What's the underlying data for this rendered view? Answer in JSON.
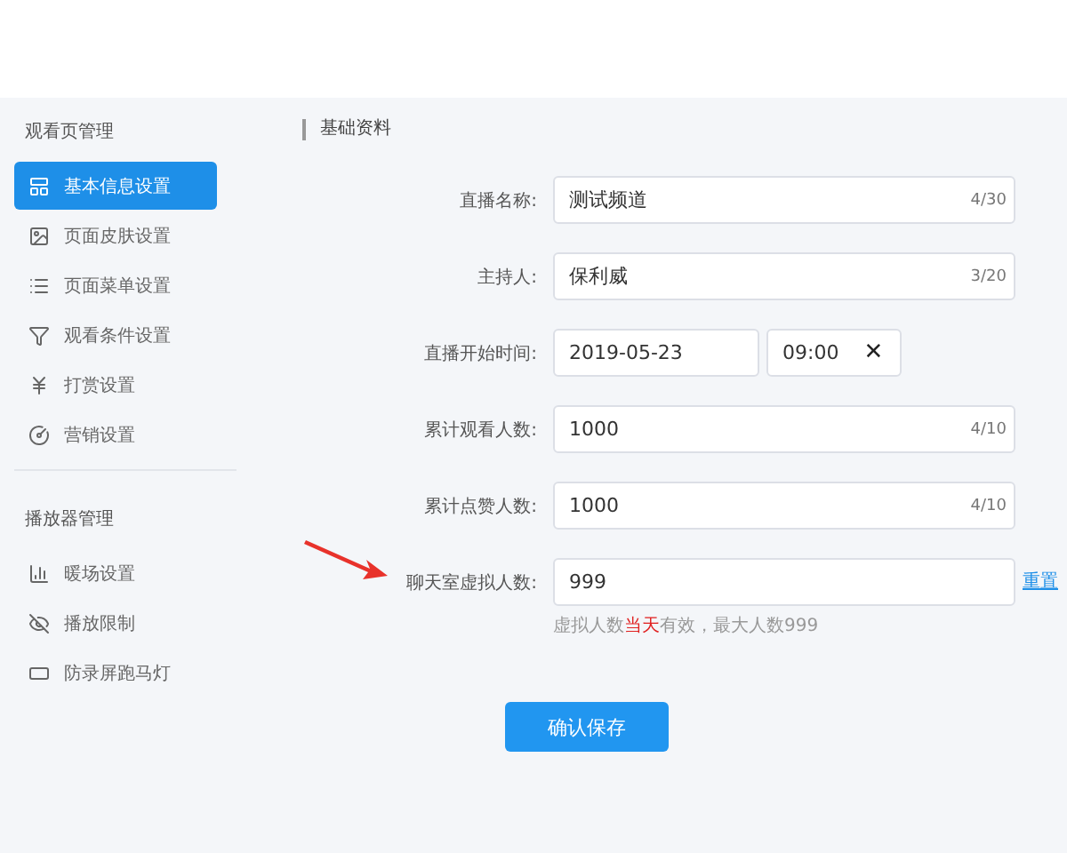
{
  "sidebar": {
    "groups": [
      {
        "title": "观看页管理",
        "items": [
          {
            "label": "基本信息设置",
            "selected": true
          },
          {
            "label": "页面皮肤设置",
            "selected": false
          },
          {
            "label": "页面菜单设置",
            "selected": false
          },
          {
            "label": "观看条件设置",
            "selected": false
          },
          {
            "label": "打赏设置",
            "selected": false
          },
          {
            "label": "营销设置",
            "selected": false
          }
        ]
      },
      {
        "title": "播放器管理",
        "items": [
          {
            "label": "暖场设置",
            "selected": false
          },
          {
            "label": "播放限制",
            "selected": false
          },
          {
            "label": "防录屏跑马灯",
            "selected": false
          }
        ]
      }
    ]
  },
  "section_title": "基础资料",
  "form": {
    "fields": [
      {
        "kind": "text",
        "label": "直播名称:",
        "value": "测试频道",
        "counter": "4/30"
      },
      {
        "kind": "text",
        "label": "主持人:",
        "value": "保利威",
        "counter": "3/20"
      },
      {
        "kind": "datetime",
        "label": "直播开始时间:",
        "date": "2019-05-23",
        "time": "09:00",
        "clear": "✕"
      },
      {
        "kind": "text",
        "label": "累计观看人数:",
        "value": "1000",
        "counter": "4/10"
      },
      {
        "kind": "text",
        "label": "累计点赞人数:",
        "value": "1000",
        "counter": "4/10"
      },
      {
        "kind": "text",
        "label": "聊天室虚拟人数:",
        "value": "999",
        "pointed": true,
        "link": "重置",
        "hint": [
          {
            "text": "虚拟人数",
            "highlight": false
          },
          {
            "text": "当天",
            "highlight": true
          },
          {
            "text": "有效，最大人数999",
            "highlight": false
          }
        ]
      }
    ]
  },
  "submit": "确认保存"
}
